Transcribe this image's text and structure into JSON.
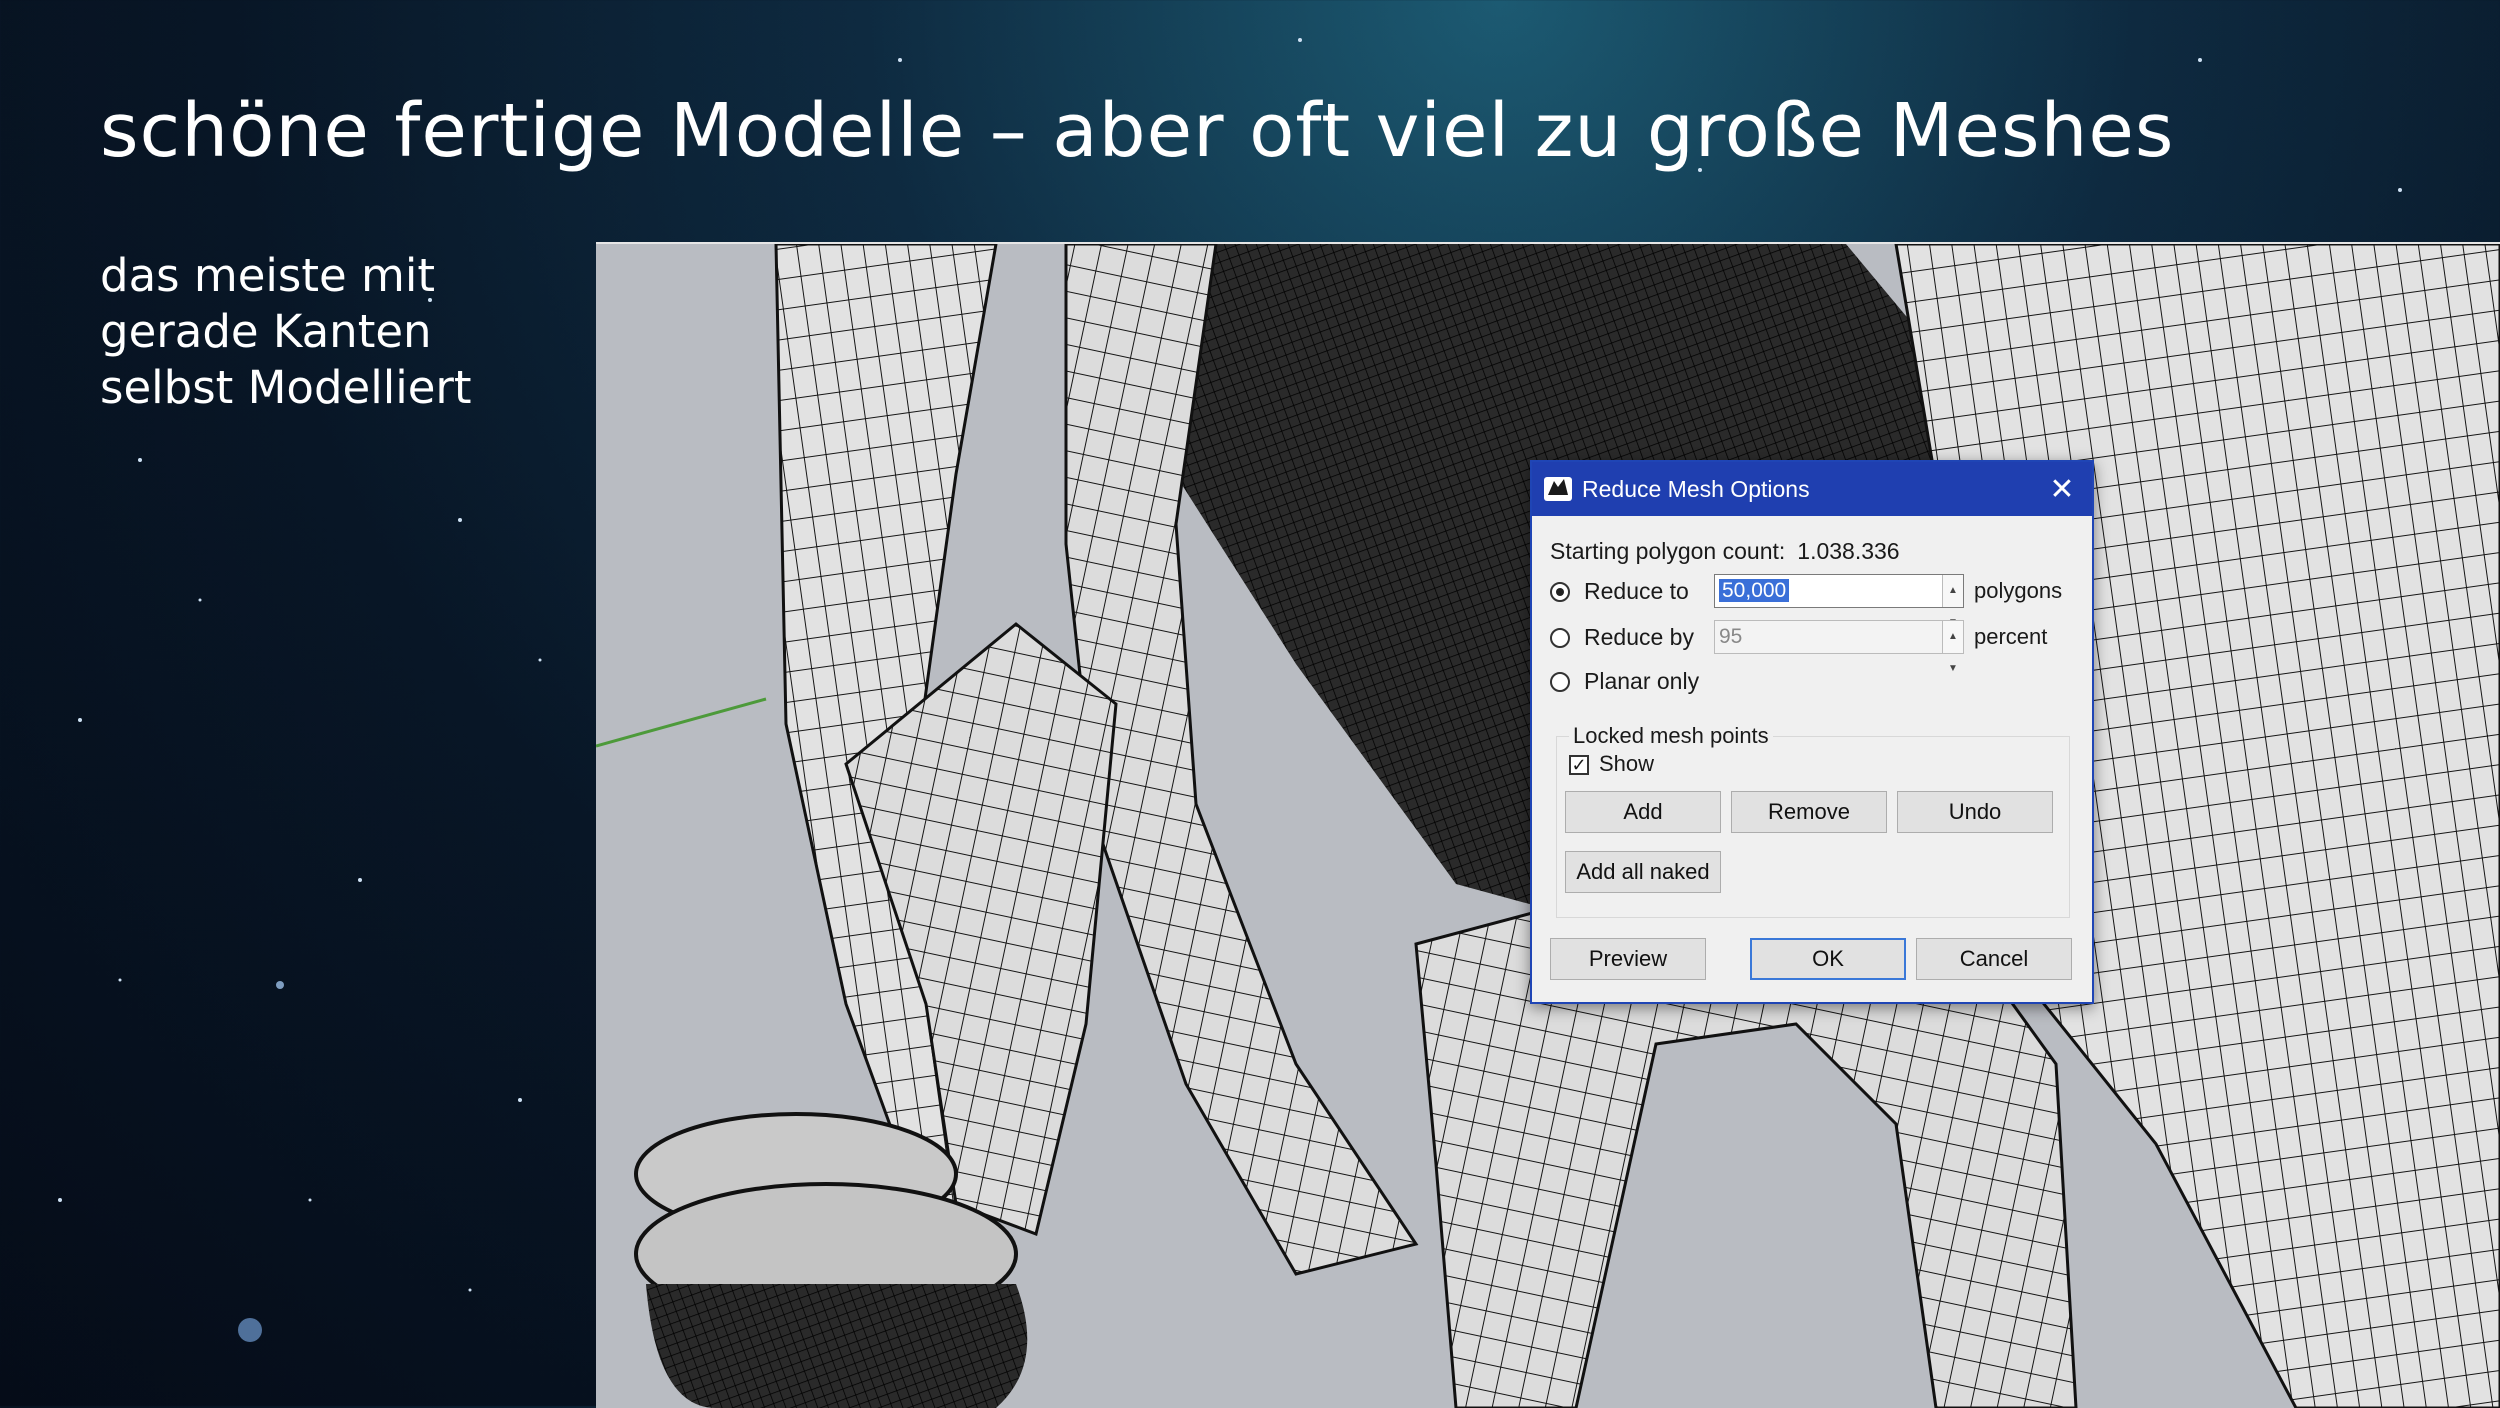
{
  "slide": {
    "title": "schöne fertige Modelle – aber oft viel zu große Meshes",
    "subtitle_lines": [
      "das meiste mit",
      "gerade Kanten",
      "selbst Modelliert"
    ]
  },
  "dialog": {
    "title": "Reduce Mesh Options",
    "app_icon": "rhino-icon",
    "close_icon": "close-icon",
    "starting_label": "Starting polygon count:",
    "starting_value": "1.038.336",
    "reduce_to": {
      "label": "Reduce to",
      "value": "50,000",
      "unit": "polygons",
      "selected": true
    },
    "reduce_by": {
      "label": "Reduce by",
      "value": "95",
      "unit": "percent",
      "selected": false
    },
    "planar_only": {
      "label": "Planar only",
      "selected": false
    },
    "locked_group": {
      "label": "Locked mesh points",
      "show_label": "Show",
      "show_checked": true,
      "add": "Add",
      "remove": "Remove",
      "undo": "Undo",
      "add_all_naked": "Add all naked"
    },
    "preview": "Preview",
    "ok": "OK",
    "cancel": "Cancel"
  },
  "colors": {
    "title_bar": "#1f3fb0",
    "viewport_bg": "#b9bcc2",
    "mesh_fill": "#d9d9d9",
    "mesh_line": "#111111"
  }
}
